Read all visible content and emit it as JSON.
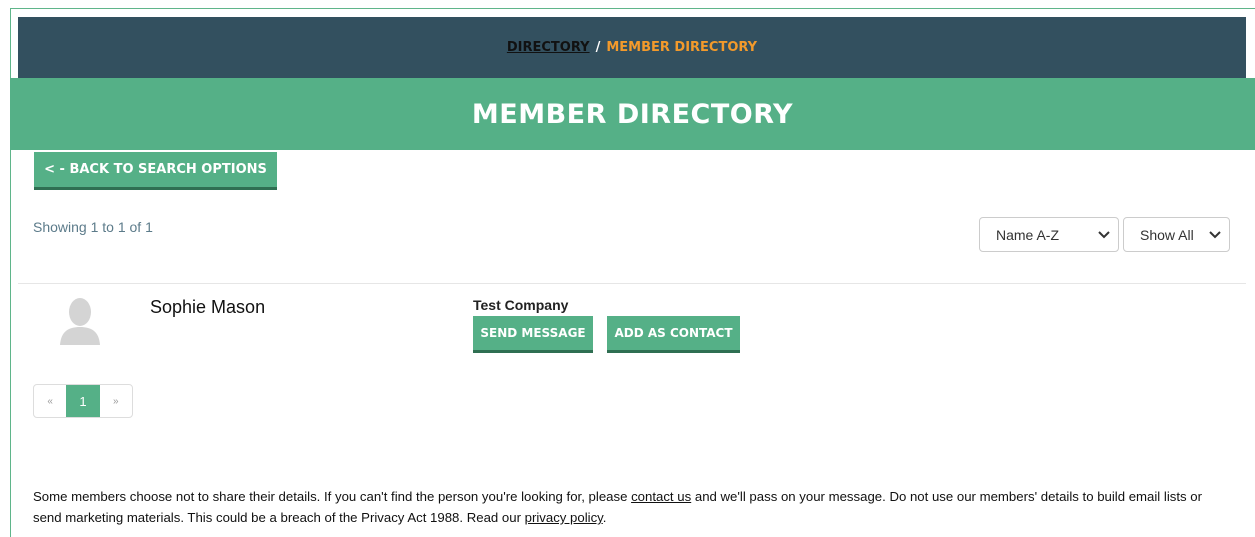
{
  "breadcrumb": {
    "link": "DIRECTORY",
    "separator": "/",
    "current": "MEMBER DIRECTORY"
  },
  "page_title": "MEMBER DIRECTORY",
  "back_button": "< - BACK TO SEARCH OPTIONS",
  "results": {
    "showing": "Showing 1 to 1 of 1"
  },
  "filters": {
    "sort": "Name A-Z",
    "show": "Show All"
  },
  "member": {
    "name": "Sophie Mason",
    "company": "Test Company",
    "send_message": "SEND MESSAGE",
    "add_contact": "ADD AS CONTACT"
  },
  "pagination": {
    "prev": "«",
    "current": "1",
    "next": "»"
  },
  "notice": {
    "part1": "Some members choose not to share their details. If you can't find the person you're looking for, please ",
    "contact_link": "contact us",
    "part2": " and we'll pass on your message. Do not use our members' details to build email lists or send marketing materials. This could be a breach of the Privacy Act 1988. Read our ",
    "privacy_link": "privacy policy",
    "part3": "."
  },
  "colors": {
    "header_bg": "#33505f",
    "accent": "#55b087",
    "crumb_current": "#f39a2b"
  },
  "icons": {
    "avatar": "person-silhouette-icon",
    "chevron": "chevron-down-icon"
  }
}
